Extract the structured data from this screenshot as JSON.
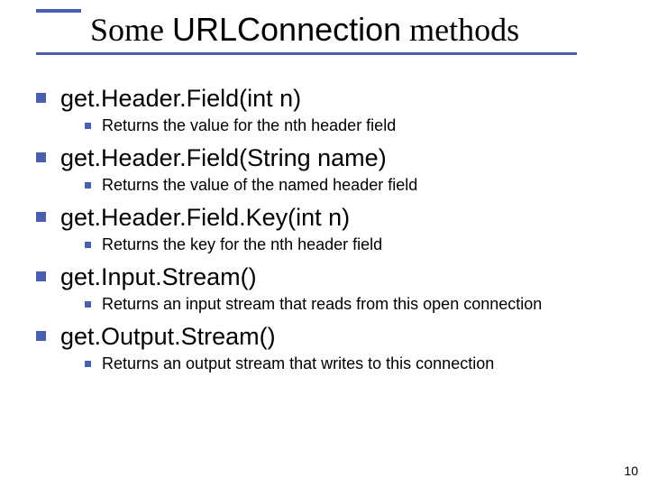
{
  "title": {
    "part1": "Some ",
    "code": "URLConnection",
    "part2": " methods"
  },
  "items": [
    {
      "method": "get.Header.Field(int n)",
      "desc": "Returns the value for the nth header field"
    },
    {
      "method": "get.Header.Field(String name)",
      "desc": "Returns the value of the named header field"
    },
    {
      "method": "get.Header.Field.Key(int n)",
      "desc": "Returns the key for the nth header field"
    },
    {
      "method": "get.Input.Stream()",
      "desc": "Returns an input stream that reads from this open connection"
    },
    {
      "method": "get.Output.Stream()",
      "desc": "Returns an output stream that writes to this connection"
    }
  ],
  "page_number": "10"
}
